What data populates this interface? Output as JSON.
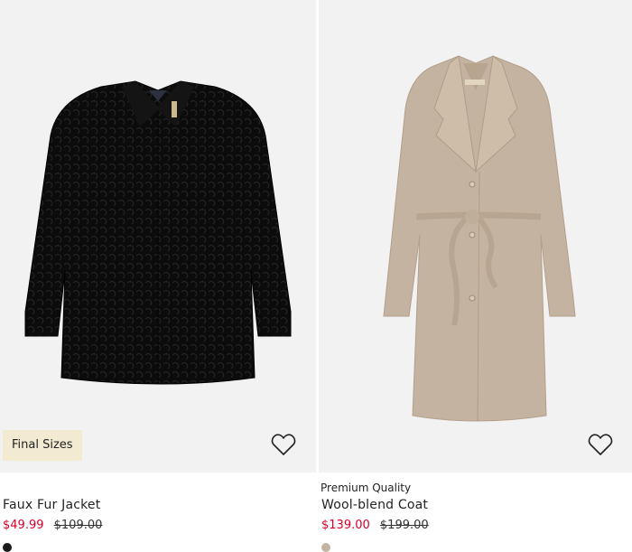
{
  "products": [
    {
      "badge": "Final Sizes",
      "tag": "",
      "name": "Faux Fur Jacket",
      "price_sale": "$49.99",
      "price_old": "$109.00",
      "swatch_color": "#1a1a1a"
    },
    {
      "badge": "",
      "tag": "Premium Quality",
      "name": "Wool-blend Coat",
      "price_sale": "$139.00",
      "price_old": "$199.00",
      "swatch_color": "#c5b3a1"
    }
  ],
  "colors": {
    "image_bg": "#f2f2f2",
    "badge_bg": "#f3ead2",
    "sale_price": "#d6002a"
  },
  "icons": {
    "favorite": "heart-outline-icon"
  }
}
